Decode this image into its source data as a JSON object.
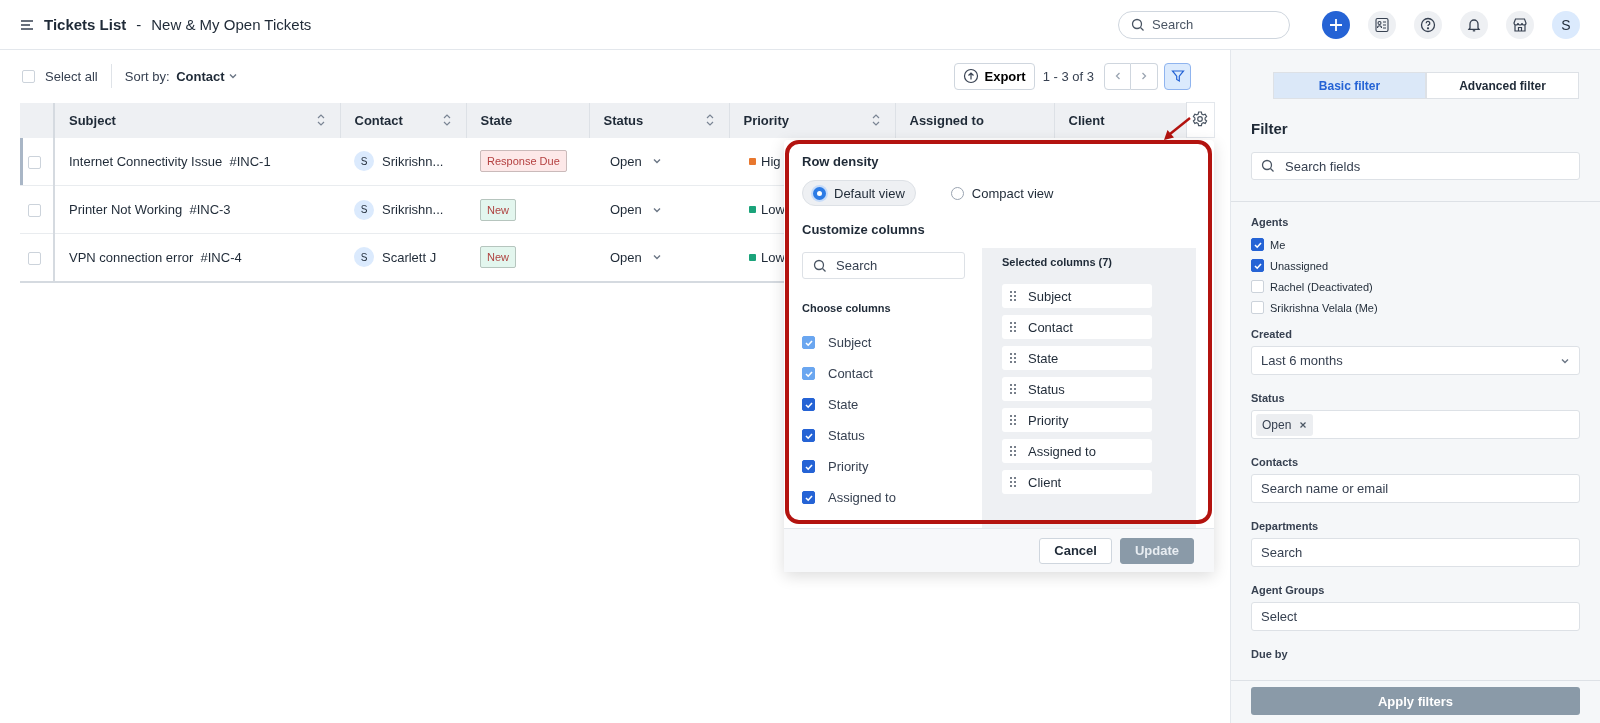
{
  "header": {
    "title": "Tickets List",
    "separator": "-",
    "subtitle": "New & My Open Tickets",
    "search_placeholder": "Search",
    "avatar": "S"
  },
  "toolbar": {
    "select_all": {
      "label": "Select all",
      "checked": false
    },
    "sort_label": "Sort by:",
    "sort_value": "Contact",
    "export": "Export",
    "range": "1 - 3 of 3",
    "filter_active": true
  },
  "table": {
    "columns": [
      {
        "label": "Subject",
        "sortable": true
      },
      {
        "label": "Contact",
        "sortable": true
      },
      {
        "label": "State",
        "sortable": false
      },
      {
        "label": "Status",
        "sortable": true
      },
      {
        "label": "Priority",
        "sortable": true
      },
      {
        "label": "Assigned to",
        "sortable": false
      },
      {
        "label": "Client",
        "sortable": false
      }
    ],
    "rows": [
      {
        "selected": true,
        "checked": false,
        "subject": "Internet Connectivity Issue",
        "ticket": "#INC-1",
        "avatar": "S",
        "contact": "Srikrishn...",
        "state": {
          "label": "Response Due",
          "color": "#fde8e8"
        },
        "status": "Open",
        "priority": {
          "label": "Hig",
          "color": "#e8772e"
        }
      },
      {
        "selected": false,
        "checked": false,
        "subject": "Printer Not Working",
        "ticket": "#INC-3",
        "avatar": "S",
        "contact": "Srikrishn...",
        "state": {
          "label": "New",
          "color": "#e3f6ee"
        },
        "status": "Open",
        "priority": {
          "label": "Low",
          "color": "#1aa37a"
        }
      },
      {
        "selected": false,
        "checked": false,
        "subject": "VPN connection error",
        "ticket": "#INC-4",
        "avatar": "S",
        "contact": "Scarlett J",
        "state": {
          "label": "New",
          "color": "#e3f6ee"
        },
        "status": "Open",
        "priority": {
          "label": "Low",
          "color": "#1aa37a"
        }
      }
    ]
  },
  "column_settings": {
    "density_title": "Row density",
    "density_options": [
      {
        "label": "Default view",
        "selected": true
      },
      {
        "label": "Compact view",
        "selected": false
      }
    ],
    "customize_title": "Customize columns",
    "search_placeholder": "Search",
    "choose_title": "Choose columns",
    "choices": [
      {
        "label": "Subject",
        "checked": true,
        "disabled": true
      },
      {
        "label": "Contact",
        "checked": true,
        "disabled": true
      },
      {
        "label": "State",
        "checked": true,
        "disabled": false
      },
      {
        "label": "Status",
        "checked": true,
        "disabled": false
      },
      {
        "label": "Priority",
        "checked": true,
        "disabled": false
      },
      {
        "label": "Assigned to",
        "checked": true,
        "disabled": false
      }
    ],
    "selected_title": "Selected columns (7)",
    "selected_columns": [
      "Subject",
      "Contact",
      "State",
      "Status",
      "Priority",
      "Assigned to",
      "Client"
    ],
    "cancel": "Cancel",
    "update": {
      "label": "Update",
      "disabled": true
    }
  },
  "filter_panel": {
    "tabs": [
      {
        "label": "Basic filter",
        "selected": true
      },
      {
        "label": "Advanced filter",
        "selected": false
      }
    ],
    "title": "Filter",
    "search_placeholder": "Search fields",
    "agents": {
      "label": "Agents",
      "options": [
        {
          "label": "Me",
          "checked": true
        },
        {
          "label": "Unassigned",
          "checked": true
        },
        {
          "label": "Rachel (Deactivated)",
          "checked": false
        },
        {
          "label": "Srikrishna Velala (Me)",
          "checked": false
        }
      ]
    },
    "fields": [
      {
        "kind": "select",
        "label": "Created",
        "value": "Last 6 months"
      },
      {
        "kind": "tags",
        "label": "Status",
        "tags": [
          "Open"
        ]
      },
      {
        "kind": "input",
        "label": "Contacts",
        "placeholder": "Search name or email"
      },
      {
        "kind": "input",
        "label": "Departments",
        "placeholder": "Search"
      },
      {
        "kind": "input",
        "label": "Agent Groups",
        "placeholder": "Select"
      },
      {
        "kind": "label",
        "label": "Due by"
      }
    ],
    "apply": {
      "label": "Apply filters",
      "disabled": true
    }
  }
}
